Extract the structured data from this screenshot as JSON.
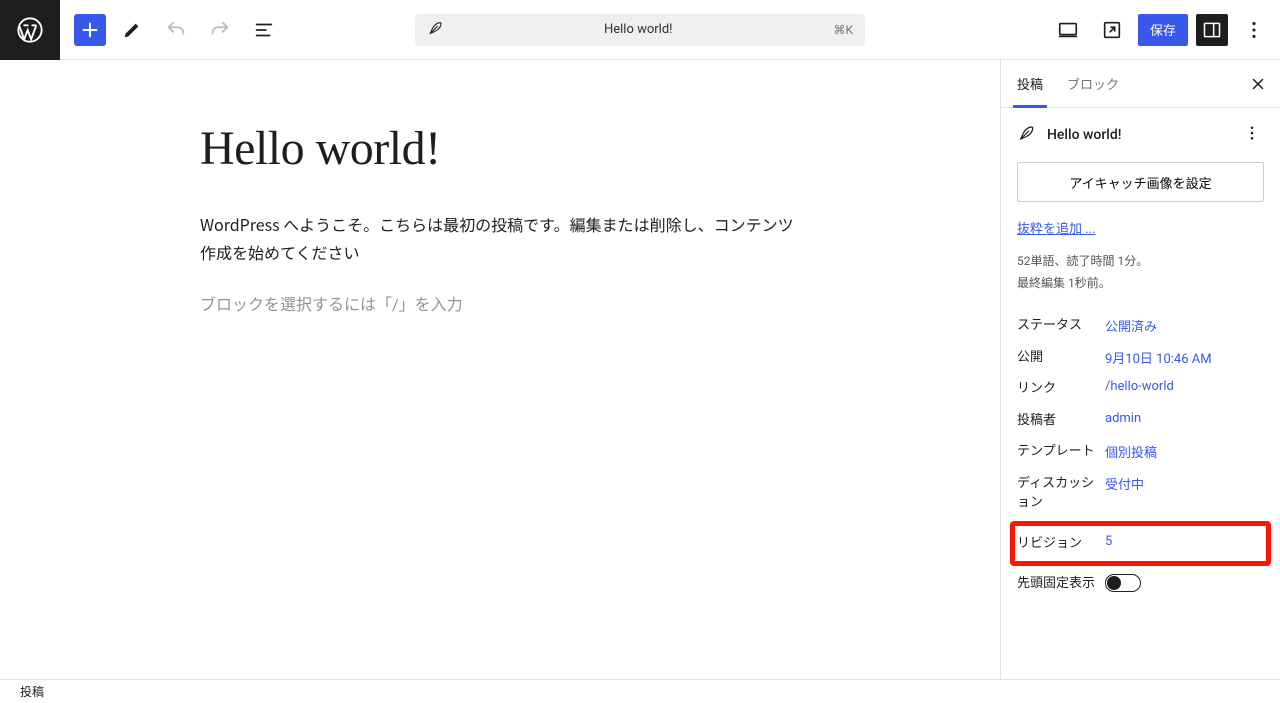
{
  "header": {
    "command_title": "Hello world!",
    "command_shortcut": "⌘K",
    "save_label": "保存"
  },
  "canvas": {
    "title": "Hello world!",
    "body": "WordPress へようこそ。こちらは最初の投稿です。編集または削除し、コンテンツ作成を始めてください",
    "block_placeholder": "ブロックを選択するには「/」を入力"
  },
  "sidebar": {
    "tabs": {
      "post": "投稿",
      "block": "ブロック"
    },
    "post_name": "Hello world!",
    "featured_button": "アイキャッチ画像を設定",
    "excerpt_link": "抜粋を追加 ...",
    "meta_line1": "52単語、読了時間 1分。",
    "meta_line2": "最終編集 1秒前。",
    "rows": {
      "status": {
        "label": "ステータス",
        "value": "公開済み"
      },
      "publish": {
        "label": "公開",
        "value": "9月10日 10:46 AM"
      },
      "link": {
        "label": "リンク",
        "value": "/hello-world"
      },
      "author": {
        "label": "投稿者",
        "value": "admin"
      },
      "template": {
        "label": "テンプレート",
        "value": "個別投稿"
      },
      "discussion": {
        "label": "ディスカッション",
        "value": "受付中"
      },
      "revisions": {
        "label": "リビジョン",
        "value": "5"
      },
      "sticky": {
        "label": "先頭固定表示"
      }
    }
  },
  "breadcrumb": "投稿"
}
